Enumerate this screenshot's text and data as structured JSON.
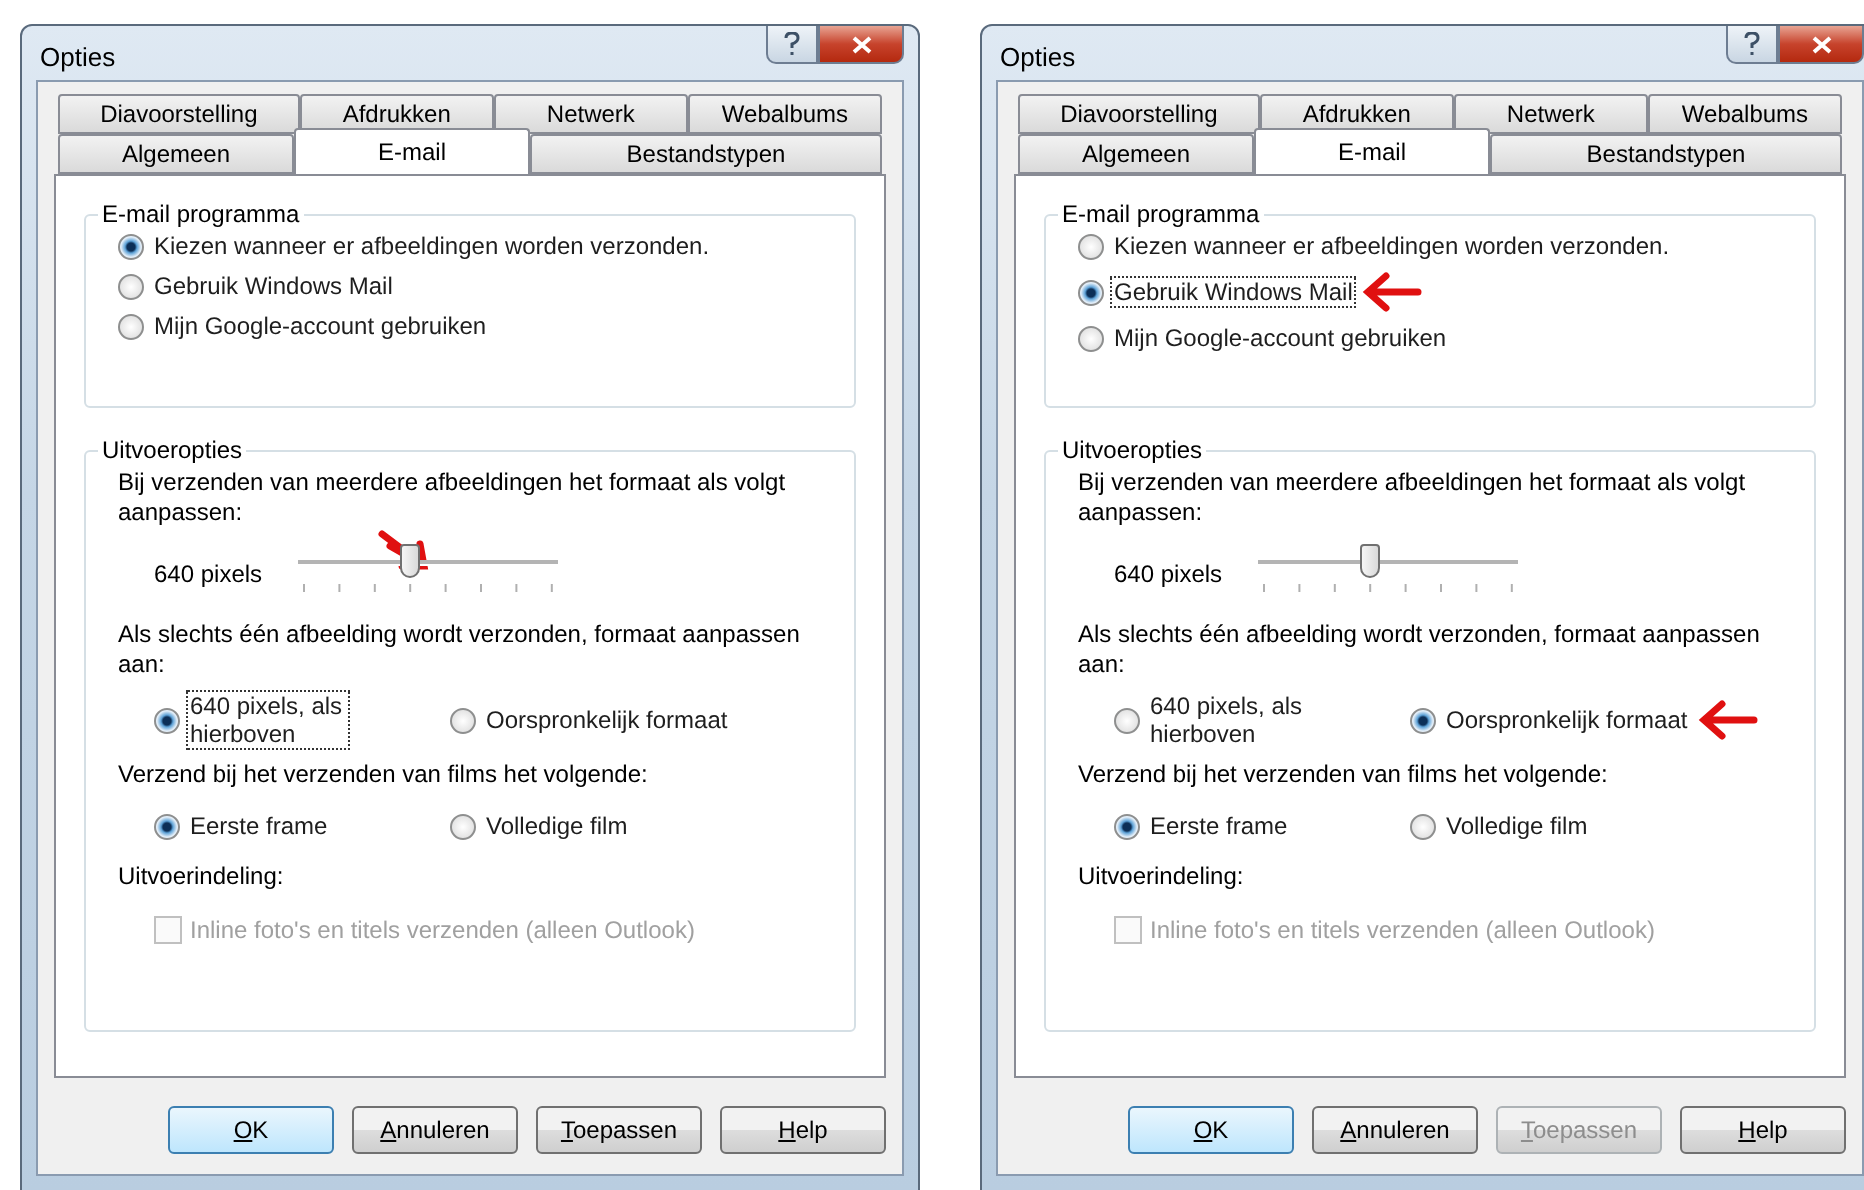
{
  "dialogs": [
    {
      "title": "Opties",
      "tabs_back": [
        {
          "label": "Diavoorstelling",
          "selected": false
        },
        {
          "label": "Afdrukken",
          "selected": false
        },
        {
          "label": "Netwerk",
          "selected": false
        },
        {
          "label": "Webalbums",
          "selected": false
        }
      ],
      "tabs_front": [
        {
          "label": "Algemeen",
          "selected": false
        },
        {
          "label": "E-mail",
          "selected": true
        },
        {
          "label": "Bestandstypen",
          "selected": false
        }
      ],
      "program_group": {
        "legend": "E-mail programma",
        "options": [
          {
            "label": "Kiezen wanneer er afbeeldingen worden verzonden.",
            "selected": true,
            "focused": false,
            "marked": false
          },
          {
            "label": "Gebruik Windows Mail",
            "selected": false,
            "focused": false,
            "marked": false
          },
          {
            "label": "Mijn Google-account gebruiken",
            "selected": false,
            "focused": false,
            "marked": false
          }
        ]
      },
      "output_group": {
        "legend": "Uitvoeropties",
        "resize_text": "Bij verzenden van meerdere afbeeldingen het formaat als volgt aanpassen:",
        "slider": {
          "label": "640 pixels",
          "level": 0.43,
          "marked": true
        },
        "single_text": "Als slechts één afbeelding wordt verzonden, formaat aanpassen aan:",
        "single_options": [
          {
            "label": "640 pixels, als hierboven",
            "selected": true,
            "focused": true,
            "marked": false
          },
          {
            "label": "Oorspronkelijk formaat",
            "selected": false,
            "focused": false,
            "marked": false
          }
        ],
        "film_text": "Verzend bij het verzenden van films het volgende:",
        "film_options": [
          {
            "label": "Eerste frame",
            "selected": true,
            "focused": false,
            "marked": false
          },
          {
            "label": "Volledige film",
            "selected": false,
            "focused": false,
            "marked": false
          }
        ],
        "layout_label": "Uitvoerindeling:",
        "inline_checkbox": {
          "label": "Inline foto's en titels verzenden (alleen Outlook)",
          "checked": false,
          "disabled": true
        }
      },
      "buttons": [
        {
          "label": "OK",
          "kind": "default",
          "disabled": false
        },
        {
          "label": "Annuleren",
          "kind": "normal",
          "disabled": false
        },
        {
          "label": "Toepassen",
          "kind": "normal",
          "disabled": false
        },
        {
          "label": "Help",
          "kind": "normal",
          "disabled": false
        }
      ]
    },
    {
      "title": "Opties",
      "tabs_back": [
        {
          "label": "Diavoorstelling",
          "selected": false
        },
        {
          "label": "Afdrukken",
          "selected": false
        },
        {
          "label": "Netwerk",
          "selected": false
        },
        {
          "label": "Webalbums",
          "selected": false
        }
      ],
      "tabs_front": [
        {
          "label": "Algemeen",
          "selected": false
        },
        {
          "label": "E-mail",
          "selected": true
        },
        {
          "label": "Bestandstypen",
          "selected": false
        }
      ],
      "program_group": {
        "legend": "E-mail programma",
        "options": [
          {
            "label": "Kiezen wanneer er afbeeldingen worden verzonden.",
            "selected": false,
            "focused": false,
            "marked": false
          },
          {
            "label": "Gebruik Windows Mail",
            "selected": true,
            "focused": true,
            "marked": true
          },
          {
            "label": "Mijn Google-account gebruiken",
            "selected": false,
            "focused": false,
            "marked": false
          }
        ]
      },
      "output_group": {
        "legend": "Uitvoeropties",
        "resize_text": "Bij verzenden van meerdere afbeeldingen het formaat als volgt aanpassen:",
        "slider": {
          "label": "640 pixels",
          "level": 0.43,
          "marked": false
        },
        "single_text": "Als slechts één afbeelding wordt verzonden, formaat aanpassen aan:",
        "single_options": [
          {
            "label": "640 pixels, als hierboven",
            "selected": false,
            "focused": false,
            "marked": false
          },
          {
            "label": "Oorspronkelijk formaat",
            "selected": true,
            "focused": false,
            "marked": true
          }
        ],
        "film_text": "Verzend bij het verzenden van films het volgende:",
        "film_options": [
          {
            "label": "Eerste frame",
            "selected": true,
            "focused": false,
            "marked": false
          },
          {
            "label": "Volledige film",
            "selected": false,
            "focused": false,
            "marked": false
          }
        ],
        "layout_label": "Uitvoerindeling:",
        "inline_checkbox": {
          "label": "Inline foto's en titels verzenden (alleen Outlook)",
          "checked": false,
          "disabled": true
        }
      },
      "buttons": [
        {
          "label": "OK",
          "kind": "default",
          "disabled": false
        },
        {
          "label": "Annuleren",
          "kind": "normal",
          "disabled": false
        },
        {
          "label": "Toepassen",
          "kind": "normal",
          "disabled": true
        },
        {
          "label": "Help",
          "kind": "normal",
          "disabled": false
        }
      ]
    }
  ]
}
